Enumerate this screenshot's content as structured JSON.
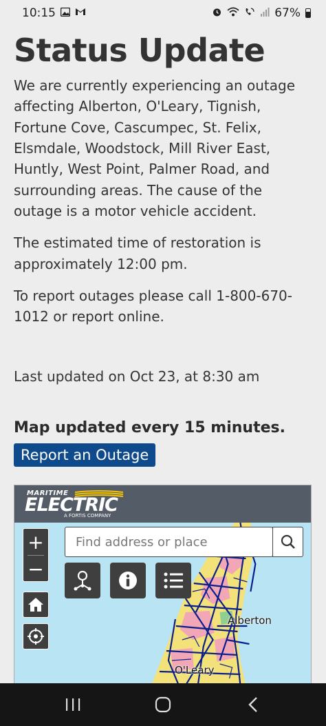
{
  "status_bar": {
    "time": "10:15",
    "battery": "67%"
  },
  "page": {
    "title": "Status Update",
    "para1": "We are currently experiencing an outage affecting Alberton, O'Leary, Tignish, Fortune Cove, Cascumpec, St. Felix, Elsmdale, Woodstock, Mill River East, Huntly, West Point, Palmer Road, and surrounding areas. The cause of the outage is a motor vehicle accident.",
    "para2": "The estimated time of restoration is approximately 12:00 pm.",
    "para3": "To report outages please call 1-800-670-1012 or report online.",
    "last_updated": "Last updated on Oct 23, at 8:30 am",
    "map_note": "Map updated every 15 minutes.",
    "report_button": "Report an Outage"
  },
  "map": {
    "logo_top": "MARITIME",
    "logo_main": "ELECTRIC",
    "logo_sub": "A FORTIS COMPANY",
    "zoom_in": "+",
    "zoom_out": "−",
    "search_placeholder": "Find address or place",
    "labels": {
      "alberton": "Alberton",
      "oleary": "O'Leary"
    },
    "colors": {
      "water": "#b8e4f4",
      "land_yellow": "#f3e27a",
      "land_pink": "#f1a7b6",
      "land_green": "#8fcf8f",
      "lines": "#0a1e8c"
    }
  }
}
